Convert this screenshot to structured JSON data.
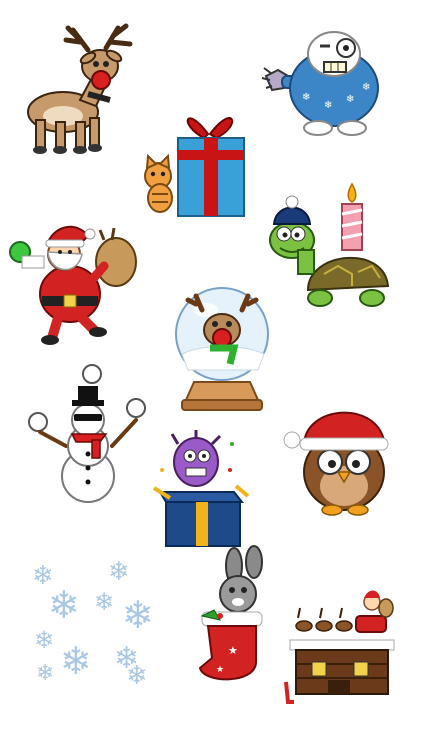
{
  "stickers": [
    {
      "id": "reindeer",
      "icon": "reindeer-icon"
    },
    {
      "id": "yeti",
      "icon": "yeti-icon"
    },
    {
      "id": "gift-with-kitten",
      "icon": "gift-kitten-icon"
    },
    {
      "id": "santa-with-sack",
      "icon": "santa-sack-icon"
    },
    {
      "id": "turtle-with-candle",
      "icon": "turtle-candle-icon"
    },
    {
      "id": "reindeer-snow-globe",
      "icon": "snow-globe-icon"
    },
    {
      "id": "snowman-juggling",
      "icon": "snowman-icon"
    },
    {
      "id": "owl-santa-hat",
      "icon": "owl-hat-icon"
    },
    {
      "id": "monster-in-box",
      "icon": "monster-box-icon"
    },
    {
      "id": "snowflakes",
      "icon": "snowflakes-icon"
    },
    {
      "id": "bunny-in-stocking",
      "icon": "bunny-stocking-icon"
    },
    {
      "id": "santa-sleigh-rooftop",
      "icon": "santa-rooftop-icon"
    }
  ],
  "colors": {
    "background": "#ffffff",
    "santa_red": "#d32222",
    "gift_blue": "#3aa0d8",
    "ribbon_red": "#c81414",
    "reindeer_brown": "#c69a6b",
    "yeti_sweater": "#3c86c8",
    "turtle_green": "#7cc242",
    "snowflake": "#aac8e6"
  }
}
